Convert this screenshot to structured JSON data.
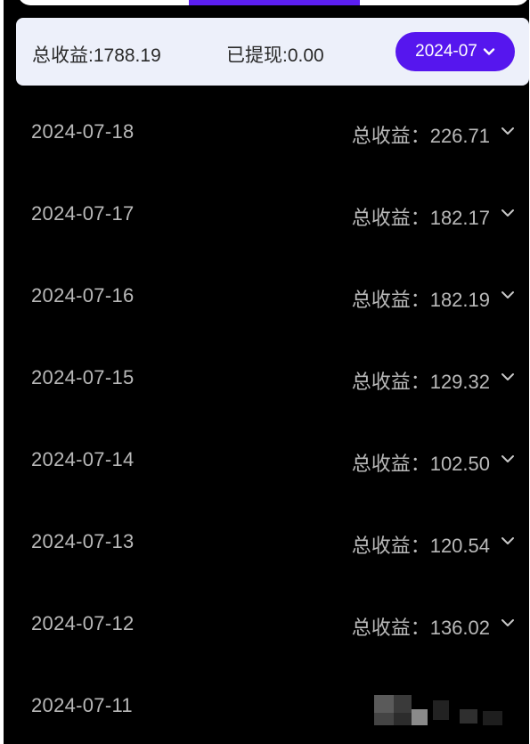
{
  "summary": {
    "total_label": "总收益:1788.19",
    "withdrawn_label": "已提现:0.00",
    "month": "2024-07"
  },
  "earning_prefix": "总收益：",
  "days": [
    {
      "date": "2024-07-18",
      "amount": "226.71"
    },
    {
      "date": "2024-07-17",
      "amount": "182.17"
    },
    {
      "date": "2024-07-16",
      "amount": "182.19"
    },
    {
      "date": "2024-07-15",
      "amount": "129.32"
    },
    {
      "date": "2024-07-14",
      "amount": "102.50"
    },
    {
      "date": "2024-07-13",
      "amount": "120.54"
    },
    {
      "date": "2024-07-12",
      "amount": "136.02"
    },
    {
      "date": "2024-07-11",
      "amount": null
    }
  ],
  "colors": {
    "accent": "#5616ee",
    "background": "#000000",
    "card": "#edf0fa",
    "text_muted": "#b9b9b9"
  },
  "icons": {
    "month_dropdown": "chevron-down-icon",
    "row_expand": "chevron-down-icon"
  }
}
